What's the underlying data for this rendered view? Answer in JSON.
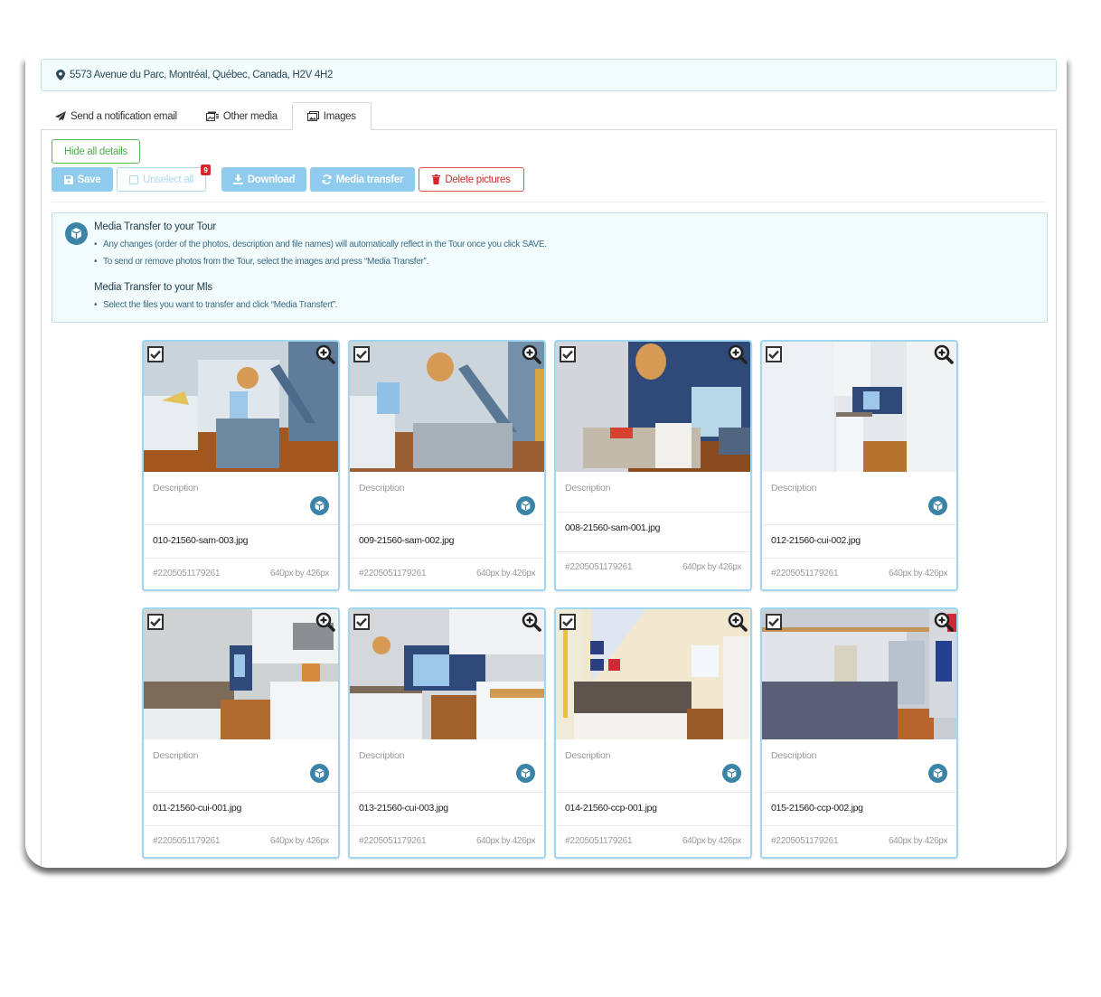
{
  "address": "5573 Avenue du Parc, Montréal, Québec, Canada, H2V 4H2",
  "tabs": [
    {
      "label": "Send a notification email",
      "icon": "paper-plane-icon",
      "active": false
    },
    {
      "label": "Other media",
      "icon": "media-icon",
      "active": false
    },
    {
      "label": "Images",
      "icon": "images-icon",
      "active": true
    }
  ],
  "toolbar": {
    "hide_details_label": "Hide all details",
    "save_label": "Save",
    "unselect_label": "Unselect all",
    "selected_count": "9",
    "download_label": "Download",
    "media_transfer_label": "Media transfer",
    "delete_label": "Delete pictures"
  },
  "info": {
    "tour_title": "Media Transfer to your Tour",
    "tour_items": [
      "Any changes (order of the photos, description and file names) will automatically reflect in the Tour once you click SAVE.",
      "To send or remove photos from the Tour, select the images and press “Media Transfer”."
    ],
    "mls_title": "Media Transfer to your Mls",
    "mls_items": [
      "Select the files you want to transfer and click “Media Transfert”."
    ]
  },
  "colors": {
    "accent_blue": "#8fcbec",
    "card_border": "#9fd6f0",
    "danger": "#d9534f",
    "success": "#5cb85c",
    "cube_icon": "#3a84a8"
  },
  "cards": [
    {
      "scene": "dining-stairs",
      "description_placeholder": "Description",
      "filename": "010-21560-sam-003.jpg",
      "id": "#2205051179261",
      "size": "640px by 426px",
      "checked": true,
      "has_transfer_icon": true
    },
    {
      "scene": "dining-kitchen",
      "description_placeholder": "Description",
      "filename": "009-21560-sam-002.jpg",
      "id": "#2205051179261",
      "size": "640px by 426px",
      "checked": true,
      "has_transfer_icon": true
    },
    {
      "scene": "dining-living",
      "description_placeholder": "Description",
      "filename": "008-21560-sam-001.jpg",
      "id": "#2205051179261",
      "size": "640px by 426px",
      "checked": true,
      "has_transfer_icon": false
    },
    {
      "scene": "kitchen-corridor",
      "description_placeholder": "Description",
      "filename": "012-21560-cui-002.jpg",
      "id": "#2205051179261",
      "size": "640px by 426px",
      "checked": true,
      "has_transfer_icon": true
    },
    {
      "scene": "kitchen-stove",
      "description_placeholder": "Description",
      "filename": "011-21560-cui-001.jpg",
      "id": "#2205051179261",
      "size": "640px by 426px",
      "checked": true,
      "has_transfer_icon": true
    },
    {
      "scene": "kitchen-counter",
      "description_placeholder": "Description",
      "filename": "013-21560-cui-003.jpg",
      "id": "#2205051179261",
      "size": "640px by 426px",
      "checked": true,
      "has_transfer_icon": true
    },
    {
      "scene": "bedroom-attic",
      "description_placeholder": "Description",
      "filename": "014-21560-ccp-001.jpg",
      "id": "#2205051179261",
      "size": "640px by 426px",
      "checked": true,
      "has_transfer_icon": true
    },
    {
      "scene": "bedroom-hall",
      "description_placeholder": "Description",
      "filename": "015-21560-ccp-002.jpg",
      "id": "#2205051179261",
      "size": "640px by 426px",
      "checked": true,
      "has_transfer_icon": true
    }
  ]
}
